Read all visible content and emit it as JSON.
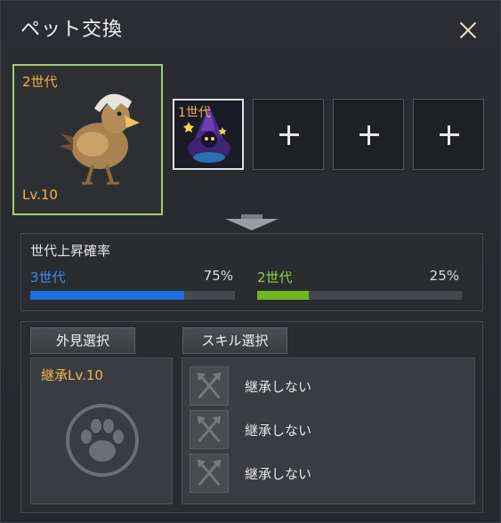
{
  "window": {
    "title": "ペット交換"
  },
  "main_pet": {
    "generation": "2世代",
    "level": "Lv.10"
  },
  "sub_slots": [
    {
      "generation": "1世代",
      "filled": true
    },
    {
      "filled": false,
      "icon": "plus-icon"
    },
    {
      "filled": false,
      "icon": "plus-icon"
    },
    {
      "filled": false,
      "icon": "plus-icon"
    }
  ],
  "rate": {
    "title": "世代上昇確率",
    "items": [
      {
        "label": "3世代",
        "percent": "75%",
        "fraction": 0.75,
        "color": "#1f6fe0",
        "label_color": "#3a8ef5"
      },
      {
        "label": "2世代",
        "percent": "25%",
        "fraction": 0.25,
        "color": "#6fb820",
        "label_color": "#8fd34a"
      }
    ]
  },
  "bottom": {
    "appearance_button": "外見選択",
    "skill_button": "スキル選択",
    "inherit_level": "継承Lv.10",
    "skills": [
      {
        "text": "継承しない",
        "icon": "axes-icon"
      },
      {
        "text": "継承しない",
        "icon": "axes-icon"
      },
      {
        "text": "継承しない",
        "icon": "axes-icon"
      }
    ]
  },
  "colors": {
    "accent_gold": "#f0b54b",
    "selected_border": "#a5cc6b"
  }
}
